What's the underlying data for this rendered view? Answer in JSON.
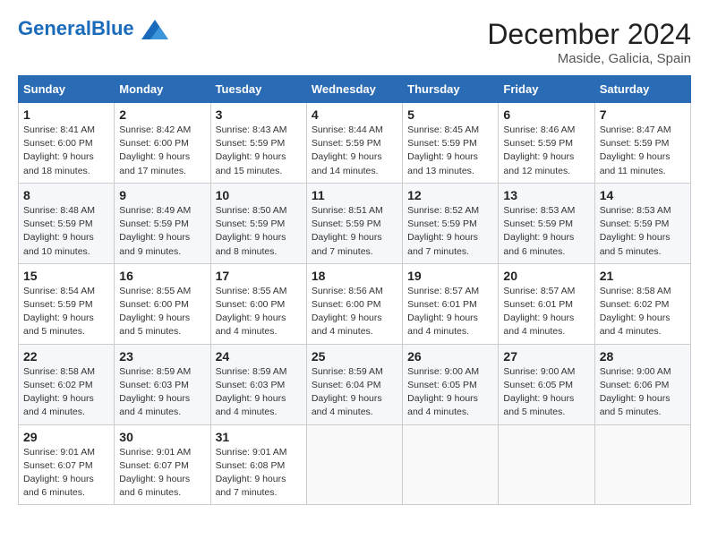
{
  "logo": {
    "text_general": "General",
    "text_blue": "Blue"
  },
  "header": {
    "month_title": "December 2024",
    "location": "Maside, Galicia, Spain"
  },
  "weekdays": [
    "Sunday",
    "Monday",
    "Tuesday",
    "Wednesday",
    "Thursday",
    "Friday",
    "Saturday"
  ],
  "weeks": [
    [
      {
        "day": "1",
        "sunrise": "8:41 AM",
        "sunset": "6:00 PM",
        "daylight": "9 hours and 18 minutes."
      },
      {
        "day": "2",
        "sunrise": "8:42 AM",
        "sunset": "6:00 PM",
        "daylight": "9 hours and 17 minutes."
      },
      {
        "day": "3",
        "sunrise": "8:43 AM",
        "sunset": "5:59 PM",
        "daylight": "9 hours and 15 minutes."
      },
      {
        "day": "4",
        "sunrise": "8:44 AM",
        "sunset": "5:59 PM",
        "daylight": "9 hours and 14 minutes."
      },
      {
        "day": "5",
        "sunrise": "8:45 AM",
        "sunset": "5:59 PM",
        "daylight": "9 hours and 13 minutes."
      },
      {
        "day": "6",
        "sunrise": "8:46 AM",
        "sunset": "5:59 PM",
        "daylight": "9 hours and 12 minutes."
      },
      {
        "day": "7",
        "sunrise": "8:47 AM",
        "sunset": "5:59 PM",
        "daylight": "9 hours and 11 minutes."
      }
    ],
    [
      {
        "day": "8",
        "sunrise": "8:48 AM",
        "sunset": "5:59 PM",
        "daylight": "9 hours and 10 minutes."
      },
      {
        "day": "9",
        "sunrise": "8:49 AM",
        "sunset": "5:59 PM",
        "daylight": "9 hours and 9 minutes."
      },
      {
        "day": "10",
        "sunrise": "8:50 AM",
        "sunset": "5:59 PM",
        "daylight": "9 hours and 8 minutes."
      },
      {
        "day": "11",
        "sunrise": "8:51 AM",
        "sunset": "5:59 PM",
        "daylight": "9 hours and 7 minutes."
      },
      {
        "day": "12",
        "sunrise": "8:52 AM",
        "sunset": "5:59 PM",
        "daylight": "9 hours and 7 minutes."
      },
      {
        "day": "13",
        "sunrise": "8:53 AM",
        "sunset": "5:59 PM",
        "daylight": "9 hours and 6 minutes."
      },
      {
        "day": "14",
        "sunrise": "8:53 AM",
        "sunset": "5:59 PM",
        "daylight": "9 hours and 5 minutes."
      }
    ],
    [
      {
        "day": "15",
        "sunrise": "8:54 AM",
        "sunset": "5:59 PM",
        "daylight": "9 hours and 5 minutes."
      },
      {
        "day": "16",
        "sunrise": "8:55 AM",
        "sunset": "6:00 PM",
        "daylight": "9 hours and 5 minutes."
      },
      {
        "day": "17",
        "sunrise": "8:55 AM",
        "sunset": "6:00 PM",
        "daylight": "9 hours and 4 minutes."
      },
      {
        "day": "18",
        "sunrise": "8:56 AM",
        "sunset": "6:00 PM",
        "daylight": "9 hours and 4 minutes."
      },
      {
        "day": "19",
        "sunrise": "8:57 AM",
        "sunset": "6:01 PM",
        "daylight": "9 hours and 4 minutes."
      },
      {
        "day": "20",
        "sunrise": "8:57 AM",
        "sunset": "6:01 PM",
        "daylight": "9 hours and 4 minutes."
      },
      {
        "day": "21",
        "sunrise": "8:58 AM",
        "sunset": "6:02 PM",
        "daylight": "9 hours and 4 minutes."
      }
    ],
    [
      {
        "day": "22",
        "sunrise": "8:58 AM",
        "sunset": "6:02 PM",
        "daylight": "9 hours and 4 minutes."
      },
      {
        "day": "23",
        "sunrise": "8:59 AM",
        "sunset": "6:03 PM",
        "daylight": "9 hours and 4 minutes."
      },
      {
        "day": "24",
        "sunrise": "8:59 AM",
        "sunset": "6:03 PM",
        "daylight": "9 hours and 4 minutes."
      },
      {
        "day": "25",
        "sunrise": "8:59 AM",
        "sunset": "6:04 PM",
        "daylight": "9 hours and 4 minutes."
      },
      {
        "day": "26",
        "sunrise": "9:00 AM",
        "sunset": "6:05 PM",
        "daylight": "9 hours and 4 minutes."
      },
      {
        "day": "27",
        "sunrise": "9:00 AM",
        "sunset": "6:05 PM",
        "daylight": "9 hours and 5 minutes."
      },
      {
        "day": "28",
        "sunrise": "9:00 AM",
        "sunset": "6:06 PM",
        "daylight": "9 hours and 5 minutes."
      }
    ],
    [
      {
        "day": "29",
        "sunrise": "9:01 AM",
        "sunset": "6:07 PM",
        "daylight": "9 hours and 6 minutes."
      },
      {
        "day": "30",
        "sunrise": "9:01 AM",
        "sunset": "6:07 PM",
        "daylight": "9 hours and 6 minutes."
      },
      {
        "day": "31",
        "sunrise": "9:01 AM",
        "sunset": "6:08 PM",
        "daylight": "9 hours and 7 minutes."
      },
      null,
      null,
      null,
      null
    ]
  ],
  "labels": {
    "sunrise": "Sunrise:",
    "sunset": "Sunset:",
    "daylight": "Daylight:"
  }
}
